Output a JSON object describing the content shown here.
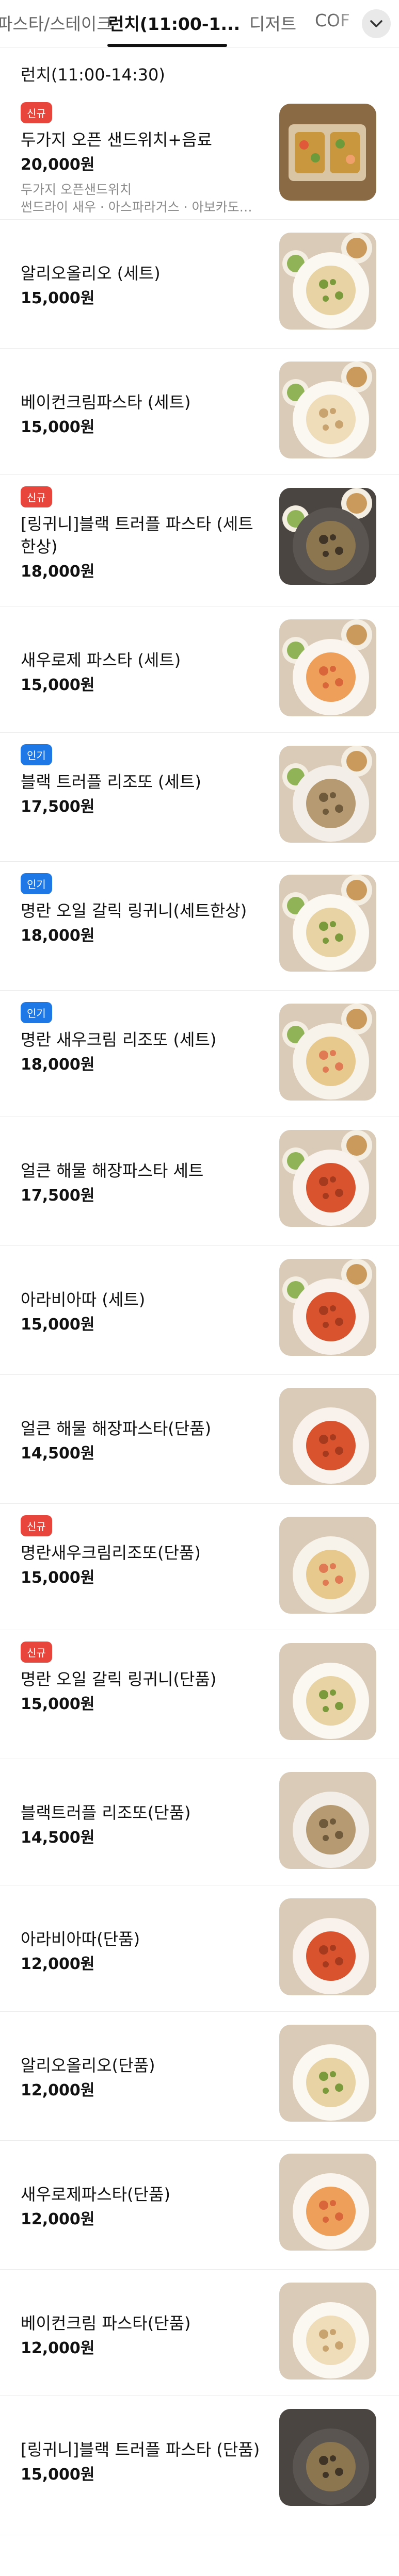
{
  "tabs": [
    {
      "label": "파스타/스테이크",
      "active": false
    },
    {
      "label": "런치(11:00-1...",
      "active": true
    },
    {
      "label": "디저트",
      "active": false
    },
    {
      "label": "COF",
      "active": false
    }
  ],
  "more_icon": "chevron-down-icon",
  "section_title": "런치(11:00-14:30)",
  "badge_labels": {
    "new": "신규",
    "popular": "인기"
  },
  "colors": {
    "new_badge": "#e8453c",
    "popular_badge": "#1e78e6"
  },
  "items": [
    {
      "badge": "new",
      "badge_label": "신규",
      "name": "두가지 오픈 샌드위치+음료",
      "price": "20,000원",
      "desc1": "두가지 오픈샌드위치",
      "desc2": "썬드라이 새우 · 아스파라거스 · 아보카도와 리코...",
      "image": "open-sandwich"
    },
    {
      "badge": "",
      "badge_label": "",
      "name": "알리오올리오 (세트)",
      "price": "15,000원",
      "image": "aglio-olio-set"
    },
    {
      "badge": "",
      "badge_label": "",
      "name": "베이컨크림파스타 (세트)",
      "price": "15,000원",
      "image": "cream-pasta-set"
    },
    {
      "badge": "new",
      "badge_label": "신규",
      "name": "[링귀니]블랙 트러플 파스타 (세트 한상)",
      "price": "18,000원",
      "image": "truffle-pasta-set"
    },
    {
      "badge": "",
      "badge_label": "",
      "name": "새우로제 파스타 (세트)",
      "price": "15,000원",
      "image": "rose-pasta-set"
    },
    {
      "badge": "popular",
      "badge_label": "인기",
      "name": "블랙 트러플 리조또 (세트)",
      "price": "17,500원",
      "image": "truffle-risotto-set"
    },
    {
      "badge": "popular",
      "badge_label": "인기",
      "name": "명란 오일 갈릭 링귀니(세트한상)",
      "price": "18,000원",
      "image": "mentaiko-linguine-set"
    },
    {
      "badge": "popular",
      "badge_label": "인기",
      "name": "명란 새우크림 리조또 (세트)",
      "price": "18,000원",
      "image": "mentaiko-risotto-set"
    },
    {
      "badge": "",
      "badge_label": "",
      "name": "얼큰 해물 해장파스타 세트",
      "price": "17,500원",
      "image": "seafood-pasta-set"
    },
    {
      "badge": "",
      "badge_label": "",
      "name": "아라비아따 (세트)",
      "price": "15,000원",
      "image": "arrabbiata-set"
    },
    {
      "badge": "",
      "badge_label": "",
      "name": "얼큰 해물 해장파스타(단품)",
      "price": "14,500원",
      "image": "seafood-pasta"
    },
    {
      "badge": "new",
      "badge_label": "신규",
      "name": "명란새우크림리조또(단품)",
      "price": "15,000원",
      "image": "mentaiko-risotto"
    },
    {
      "badge": "new",
      "badge_label": "신규",
      "name": "명란 오일 갈릭 링귀니(단품)",
      "price": "15,000원",
      "image": "mentaiko-linguine"
    },
    {
      "badge": "",
      "badge_label": "",
      "name": "블랙트러플 리조또(단품)",
      "price": "14,500원",
      "image": "truffle-risotto"
    },
    {
      "badge": "",
      "badge_label": "",
      "name": "아라비아따(단품)",
      "price": "12,000원",
      "image": "arrabbiata"
    },
    {
      "badge": "",
      "badge_label": "",
      "name": "알리오올리오(단품)",
      "price": "12,000원",
      "image": "aglio-olio"
    },
    {
      "badge": "",
      "badge_label": "",
      "name": "새우로제파스타(단품)",
      "price": "12,000원",
      "image": "rose-pasta"
    },
    {
      "badge": "",
      "badge_label": "",
      "name": "베이컨크림 파스타(단품)",
      "price": "12,000원",
      "image": "cream-pasta"
    },
    {
      "badge": "",
      "badge_label": "",
      "name": "[링귀니]블랙 트러플 파스타 (단품)",
      "price": "15,000원",
      "image": "truffle-pasta"
    }
  ]
}
